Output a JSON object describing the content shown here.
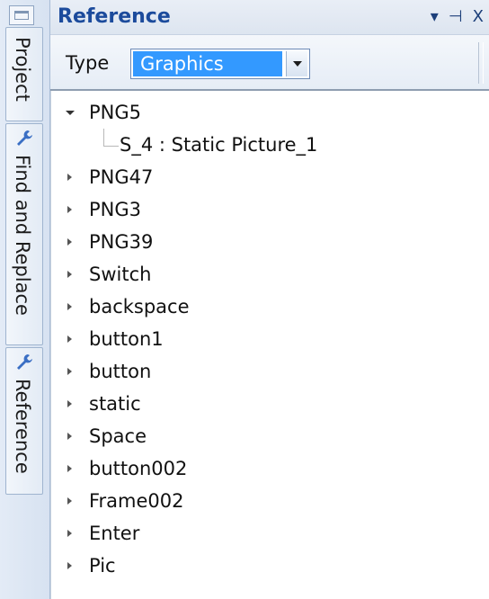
{
  "side_tabs": [
    {
      "label": "Project",
      "icon": "window-icon"
    },
    {
      "label": "Find and Replace",
      "icon": "wrench-icon"
    },
    {
      "label": "Reference",
      "icon": "wrench-icon"
    }
  ],
  "panel": {
    "title": "Reference",
    "controls": {
      "dropdown": "▾",
      "pin": "⊣",
      "close": "X"
    }
  },
  "toolbar": {
    "type_label": "Type",
    "type_value": "Graphics"
  },
  "tree": {
    "expanded_item": {
      "label": "PNG5",
      "child": "S_4 : Static Picture_1"
    },
    "items": [
      "PNG47",
      "PNG3",
      "PNG39",
      "Switch",
      "backspace",
      "button1",
      "button",
      "static",
      "Space",
      "button002",
      "Frame002",
      "Enter",
      "Pic"
    ]
  }
}
